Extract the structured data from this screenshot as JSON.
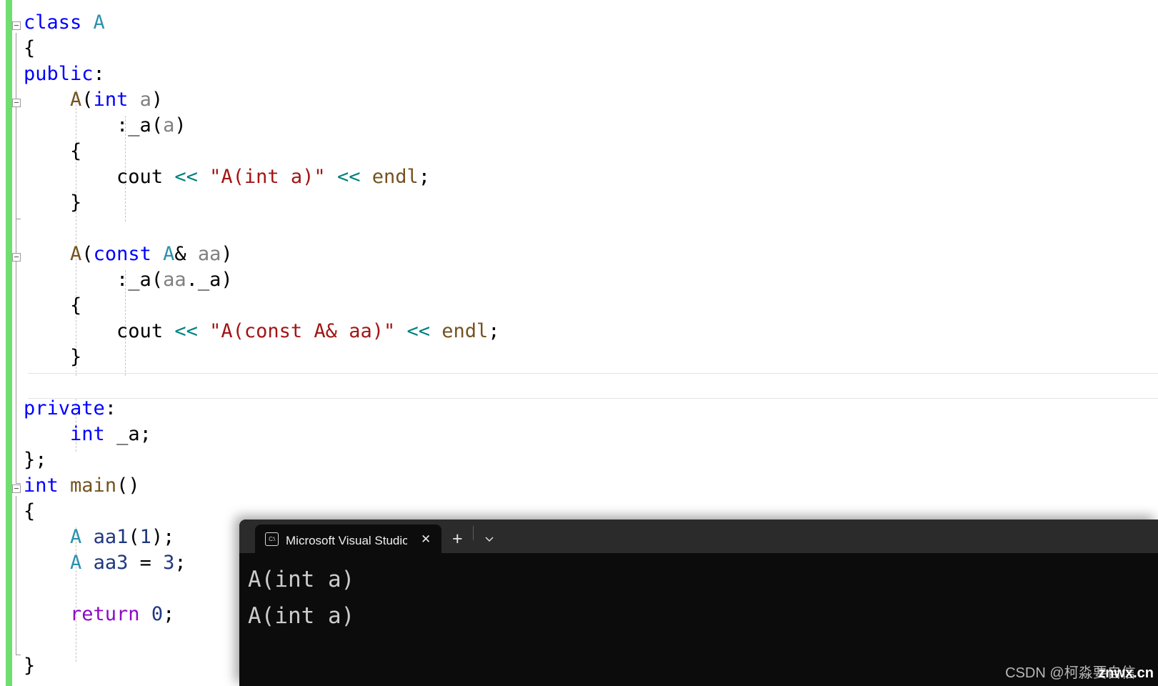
{
  "editor": {
    "name": "visual-studio-code-editor",
    "background": "#ffffff",
    "change_bar_color": "#6fdd6f",
    "code_lines": [
      {
        "indent": 0,
        "tokens": [
          {
            "t": "class",
            "c": "t-kw"
          },
          {
            "t": " ",
            "c": "t-plain"
          },
          {
            "t": "A",
            "c": "t-type"
          }
        ]
      },
      {
        "indent": 0,
        "tokens": [
          {
            "t": "{",
            "c": "t-plain"
          }
        ]
      },
      {
        "indent": 0,
        "tokens": [
          {
            "t": "public",
            "c": "t-kw"
          },
          {
            "t": ":",
            "c": "t-plain"
          }
        ]
      },
      {
        "indent": 1,
        "tokens": [
          {
            "t": "A",
            "c": "t-fn"
          },
          {
            "t": "(",
            "c": "t-plain"
          },
          {
            "t": "int",
            "c": "t-kw"
          },
          {
            "t": " ",
            "c": "t-plain"
          },
          {
            "t": "a",
            "c": "t-param"
          },
          {
            "t": ")",
            "c": "t-plain"
          }
        ]
      },
      {
        "indent": 2,
        "tokens": [
          {
            "t": ":_a(",
            "c": "t-plain"
          },
          {
            "t": "a",
            "c": "t-param"
          },
          {
            "t": ")",
            "c": "t-plain"
          }
        ]
      },
      {
        "indent": 1,
        "tokens": [
          {
            "t": "{",
            "c": "t-plain"
          }
        ]
      },
      {
        "indent": 2,
        "tokens": [
          {
            "t": "cout",
            "c": "t-plain"
          },
          {
            "t": " ",
            "c": "t-plain"
          },
          {
            "t": "<<",
            "c": "t-op"
          },
          {
            "t": " ",
            "c": "t-plain"
          },
          {
            "t": "\"A(int a)\"",
            "c": "t-str"
          },
          {
            "t": " ",
            "c": "t-plain"
          },
          {
            "t": "<<",
            "c": "t-op"
          },
          {
            "t": " ",
            "c": "t-plain"
          },
          {
            "t": "endl",
            "c": "t-fn"
          },
          {
            "t": ";",
            "c": "t-plain"
          }
        ]
      },
      {
        "indent": 1,
        "tokens": [
          {
            "t": "}",
            "c": "t-plain"
          }
        ]
      },
      {
        "indent": 0,
        "tokens": []
      },
      {
        "indent": 1,
        "tokens": [
          {
            "t": "A",
            "c": "t-fn"
          },
          {
            "t": "(",
            "c": "t-plain"
          },
          {
            "t": "const",
            "c": "t-kw"
          },
          {
            "t": " ",
            "c": "t-plain"
          },
          {
            "t": "A",
            "c": "t-type"
          },
          {
            "t": "& ",
            "c": "t-plain"
          },
          {
            "t": "aa",
            "c": "t-param"
          },
          {
            "t": ")",
            "c": "t-plain"
          }
        ]
      },
      {
        "indent": 2,
        "tokens": [
          {
            "t": ":_a(",
            "c": "t-plain"
          },
          {
            "t": "aa",
            "c": "t-param"
          },
          {
            "t": "._a)",
            "c": "t-plain"
          }
        ]
      },
      {
        "indent": 1,
        "tokens": [
          {
            "t": "{",
            "c": "t-plain"
          }
        ]
      },
      {
        "indent": 2,
        "tokens": [
          {
            "t": "cout",
            "c": "t-plain"
          },
          {
            "t": " ",
            "c": "t-plain"
          },
          {
            "t": "<<",
            "c": "t-op"
          },
          {
            "t": " ",
            "c": "t-plain"
          },
          {
            "t": "\"A(const A& aa)\"",
            "c": "t-str"
          },
          {
            "t": " ",
            "c": "t-plain"
          },
          {
            "t": "<<",
            "c": "t-op"
          },
          {
            "t": " ",
            "c": "t-plain"
          },
          {
            "t": "endl",
            "c": "t-fn"
          },
          {
            "t": ";",
            "c": "t-plain"
          }
        ]
      },
      {
        "indent": 1,
        "tokens": [
          {
            "t": "}",
            "c": "t-plain"
          }
        ]
      },
      {
        "indent": 0,
        "tokens": []
      },
      {
        "indent": 0,
        "tokens": [
          {
            "t": "private",
            "c": "t-kw"
          },
          {
            "t": ":",
            "c": "t-plain"
          }
        ]
      },
      {
        "indent": 1,
        "tokens": [
          {
            "t": "int",
            "c": "t-kw"
          },
          {
            "t": " _a;",
            "c": "t-plain"
          }
        ]
      },
      {
        "indent": 0,
        "tokens": [
          {
            "t": "};",
            "c": "t-plain"
          }
        ]
      },
      {
        "indent": 0,
        "tokens": [
          {
            "t": "int",
            "c": "t-kw"
          },
          {
            "t": " ",
            "c": "t-plain"
          },
          {
            "t": "main",
            "c": "t-fn"
          },
          {
            "t": "()",
            "c": "t-plain"
          }
        ]
      },
      {
        "indent": 0,
        "tokens": [
          {
            "t": "{",
            "c": "t-plain"
          }
        ]
      },
      {
        "indent": 1,
        "tokens": [
          {
            "t": "A",
            "c": "t-type"
          },
          {
            "t": " ",
            "c": "t-plain"
          },
          {
            "t": "aa1",
            "c": "t-var"
          },
          {
            "t": "(",
            "c": "t-plain"
          },
          {
            "t": "1",
            "c": "t-var"
          },
          {
            "t": ");",
            "c": "t-plain"
          }
        ]
      },
      {
        "indent": 1,
        "tokens": [
          {
            "t": "A",
            "c": "t-type"
          },
          {
            "t": " ",
            "c": "t-plain"
          },
          {
            "t": "aa3",
            "c": "t-var"
          },
          {
            "t": " = ",
            "c": "t-plain"
          },
          {
            "t": "3",
            "c": "t-var"
          },
          {
            "t": ";",
            "c": "t-plain"
          }
        ]
      },
      {
        "indent": 0,
        "tokens": []
      },
      {
        "indent": 1,
        "tokens": [
          {
            "t": "return",
            "c": "t-ctl"
          },
          {
            "t": " ",
            "c": "t-plain"
          },
          {
            "t": "0",
            "c": "t-var"
          },
          {
            "t": ";",
            "c": "t-plain"
          }
        ]
      },
      {
        "indent": 0,
        "tokens": []
      },
      {
        "indent": 0,
        "tokens": [
          {
            "t": "}",
            "c": "t-plain"
          }
        ]
      }
    ],
    "plain_text": "class A\n{\npublic:\n    A(int a)\n        :_a(a)\n    {\n        cout << \"A(int a)\" << endl;\n    }\n\n    A(const A& aa)\n        :_a(aa._a)\n    {\n        cout << \"A(const A& aa)\" << endl;\n    }\n\nprivate:\n    int _a;\n};\nint main()\n{\n    A aa1(1);\n    A aa3 = 3;\n\n    return 0;\n}",
    "fold_markers": [
      {
        "name": "fold-class-a",
        "line": 0
      },
      {
        "name": "fold-ctor-int",
        "line": 3
      },
      {
        "name": "fold-ctor-copy",
        "line": 9
      },
      {
        "name": "fold-main",
        "line": 18
      }
    ],
    "syntax_colors": {
      "keyword": "#0000ff",
      "user_type": "#2b91af",
      "function": "#74531f",
      "string": "#a31515",
      "operator": "#008080",
      "parameter": "#808080",
      "variable": "#1f377f",
      "control": "#8f08c4",
      "plain": "#000000"
    }
  },
  "terminal": {
    "name": "windows-terminal",
    "background": "#0c0c0c",
    "titlebar_background": "#2b2b2b",
    "tab": {
      "icon": "console-icon",
      "icon_glyph": "C:\\",
      "title": "Microsoft Visual Studio 调试控",
      "close_label": "✕"
    },
    "new_tab_label": "+",
    "dropdown_label": "⌄",
    "output_lines": [
      "A(int a)",
      "A(int a)"
    ],
    "output_text": "A(int a)\nA(int a)"
  },
  "watermark": {
    "name": "csdn-watermark",
    "credit": "CSDN @柯淼要自信",
    "logo": "znwx.cn"
  }
}
